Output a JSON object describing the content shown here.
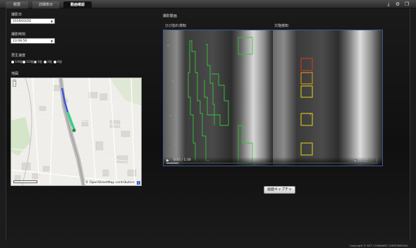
{
  "tabs": [
    {
      "label": "概要",
      "active": false
    },
    {
      "label": "詳細表示",
      "active": false
    },
    {
      "label": "動画確認",
      "active": true
    }
  ],
  "top_icons": [
    "download-icon",
    "gear-icon",
    "window-icon"
  ],
  "form": {
    "date_label": "撮影日",
    "date_value": "2019/03/20",
    "time_label": "撮影時刻",
    "time_value": "23:08:56",
    "interval_label": "再生速度",
    "interval_options": [
      "1/4倍",
      "1/2倍",
      "1倍",
      "2倍",
      "4倍"
    ],
    "interval_selected": "1倍"
  },
  "map": {
    "title": "地図",
    "zoom_in": "+",
    "zoom_out": "−",
    "attribution": "© OpenStreetMap contributors",
    "info_icon": "i"
  },
  "video": {
    "title": "撮影動画",
    "left_label": "ひび割れ検知",
    "right_label": "欠陥検知",
    "time_current": "0:05",
    "time_total": "1:30",
    "progress": 0.055
  },
  "capture_button": "画面キャプチャ",
  "footer": "Copyright © NTT COMWARE CORPORATION",
  "colors": {
    "crack_outline": "#38c23a",
    "box_red": "#d83a1a",
    "box_yellow": "#e8d418",
    "track_blue": "#3a58d8",
    "track_green": "#35d08a"
  }
}
